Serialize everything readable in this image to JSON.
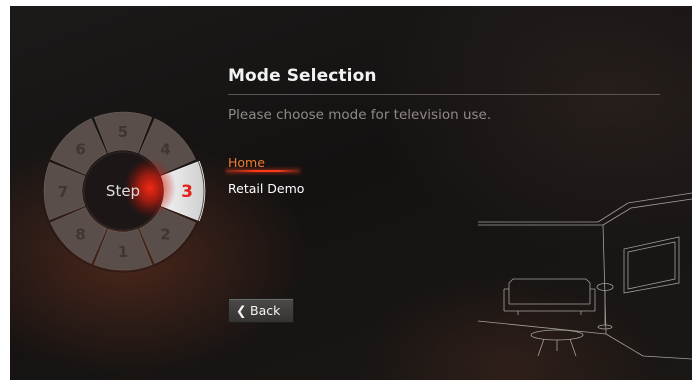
{
  "screen": {
    "title": "Mode Selection",
    "subtitle": "Please choose mode for television use."
  },
  "options": [
    {
      "label": "Home",
      "selected": true
    },
    {
      "label": "Retail Demo",
      "selected": false
    }
  ],
  "back_button": {
    "label": "Back",
    "icon": "chevron-left-icon"
  },
  "step_dial": {
    "center_label": "Step",
    "current_step": "3",
    "steps": [
      "5",
      "4",
      "3",
      "2",
      "1",
      "8",
      "7",
      "6"
    ]
  },
  "colors": {
    "accent": "#ff2a14",
    "selected_option": "#f07a2f",
    "title": "#f2f2f2",
    "subtitle": "#8f8a87"
  }
}
